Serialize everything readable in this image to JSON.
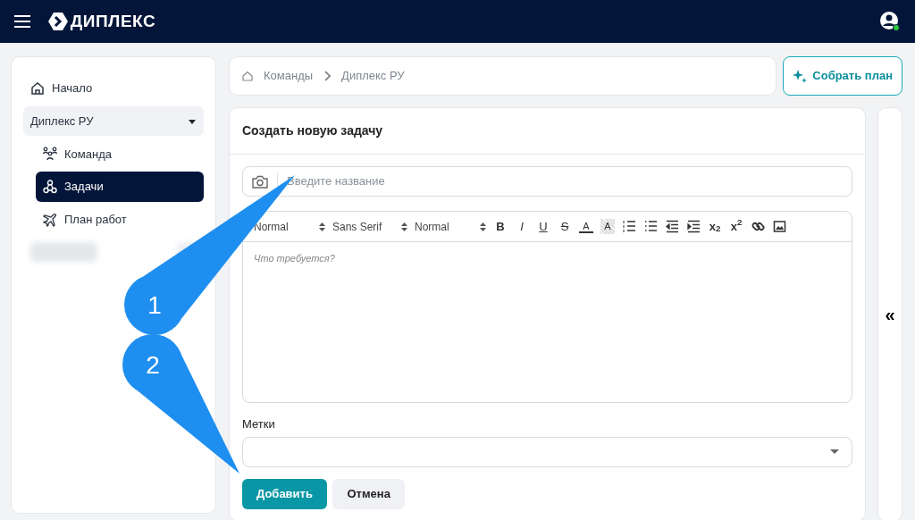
{
  "topbar": {
    "brand": "ДИПЛЕКС"
  },
  "sidebar": {
    "items": [
      {
        "label": "Начало",
        "selected": false
      },
      {
        "label": "Диплекс РУ",
        "expanded": true,
        "children": [
          {
            "label": "Команда",
            "selected": false
          },
          {
            "label": "Задачи",
            "selected": true
          },
          {
            "label": "План работ",
            "selected": false
          }
        ]
      },
      {
        "kind": "redacted"
      }
    ]
  },
  "breadcrumb": [
    "Команды",
    "Диплекс РУ"
  ],
  "plan_button": "Собрать план",
  "form": {
    "title": "Создать новую задачу",
    "name_field": {
      "placeholder": "Введите название"
    },
    "editor": {
      "pickers": [
        "Normal",
        "Sans Serif",
        "Normal"
      ],
      "tools": [
        {
          "kind": "bold",
          "label": "B"
        },
        {
          "kind": "italic",
          "label": "I"
        },
        {
          "kind": "underline",
          "label": "U"
        },
        {
          "kind": "strike",
          "label": "S"
        },
        {
          "kind": "color",
          "label": "A"
        },
        {
          "kind": "background",
          "label": "A"
        },
        {
          "kind": "ordered-list"
        },
        {
          "kind": "bullet-list"
        },
        {
          "kind": "outdent"
        },
        {
          "kind": "indent"
        },
        {
          "kind": "script",
          "label": "x$_{2}$"
        },
        {
          "kind": "script",
          "label": "x$^{2}$"
        },
        {
          "kind": "link"
        },
        {
          "kind": "image"
        }
      ],
      "placeholder": "Что требуется?"
    },
    "tags_label": "Метки",
    "buttons": [
      {
        "label": "Добавить",
        "kind": "primary"
      },
      {
        "label": "Отмена",
        "kind": "secondary"
      }
    ]
  },
  "collapse_button": "«",
  "callouts": [
    {
      "label": "1"
    },
    {
      "label": "2"
    }
  ]
}
